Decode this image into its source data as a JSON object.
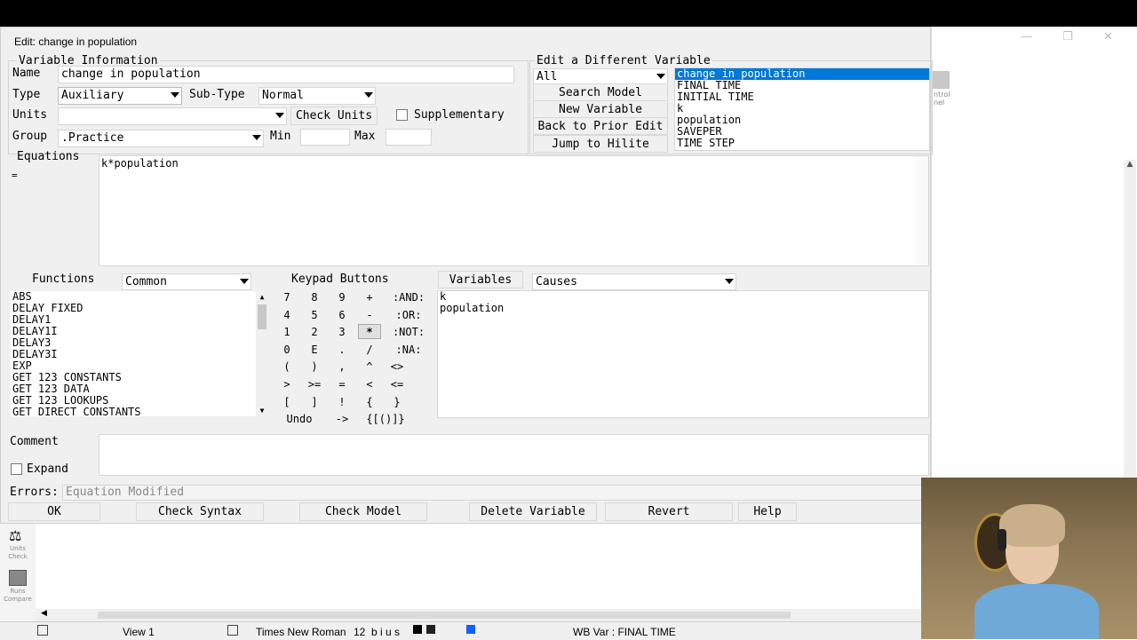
{
  "dialog": {
    "title": "Edit: change in population"
  },
  "variable_info": {
    "section_label": "Variable Information",
    "name_label": "Name",
    "name_value": "change in population",
    "type_label": "Type",
    "type_value": "Auxiliary",
    "subtype_label": "Sub-Type",
    "subtype_value": "Normal",
    "units_label": "Units",
    "units_value": "",
    "check_units_label": "Check Units",
    "supplementary_label": "Supplementary",
    "group_label": "Group",
    "group_value": ".Practice",
    "min_label": "Min",
    "max_label": "Max"
  },
  "edit_different": {
    "section_label": "Edit a Different Variable",
    "filter_value": "All",
    "search_model_label": "Search Model",
    "new_variable_label": "New Variable",
    "back_label": "Back to Prior Edit",
    "jump_label": "Jump to Hilite",
    "variables": [
      "change in population",
      "FINAL TIME",
      "INITIAL TIME",
      "k",
      "population",
      "SAVEPER",
      "TIME STEP"
    ]
  },
  "equations": {
    "label": "Equations",
    "eq_sign": "=",
    "text": "k*population"
  },
  "functions": {
    "label": "Functions",
    "category_value": "Common",
    "items": [
      "ABS",
      "DELAY FIXED",
      "DELAY1",
      "DELAY1I",
      "DELAY3",
      "DELAY3I",
      "EXP",
      "GET 123 CONSTANTS",
      "GET 123 DATA",
      "GET 123 LOOKUPS",
      "GET DIRECT CONSTANTS"
    ]
  },
  "keypad": {
    "label": "Keypad Buttons",
    "rows": [
      [
        "7",
        "8",
        "9",
        "+",
        ":AND:"
      ],
      [
        "4",
        "5",
        "6",
        "-",
        ":OR:"
      ],
      [
        "1",
        "2",
        "3",
        "*",
        ":NOT:"
      ],
      [
        "0",
        "E",
        ".",
        "/",
        ":NA:"
      ],
      [
        "(",
        ")",
        ",",
        "^",
        "<>"
      ],
      [
        ">",
        ">=",
        "=",
        "<",
        "<="
      ],
      [
        "[",
        "]",
        "!",
        "{",
        "}"
      ],
      [
        "Undo",
        "->",
        "{[()]}"
      ]
    ]
  },
  "variables_panel": {
    "label": "Variables",
    "mode_value": "Causes",
    "items": [
      "k",
      "population"
    ]
  },
  "comment": {
    "label": "Comment",
    "expand_label": "Expand"
  },
  "errors": {
    "label": "Errors:",
    "value": "Equation Modified"
  },
  "buttons": {
    "ok": "OK",
    "check_syntax": "Check Syntax",
    "check_model": "Check Model",
    "delete_variable": "Delete Variable",
    "revert": "Revert",
    "help": "Help"
  },
  "left_toolbar": {
    "units_check": "Units Check",
    "runs_compare": "Runs Compare"
  },
  "statusbar": {
    "view": "View 1",
    "font": "Times New Roman",
    "size": "12",
    "format": "b i u s",
    "wb_var": "WB Var : FINAL TIME"
  },
  "right_panel": {
    "partial_label": "ntrol\nnel"
  }
}
